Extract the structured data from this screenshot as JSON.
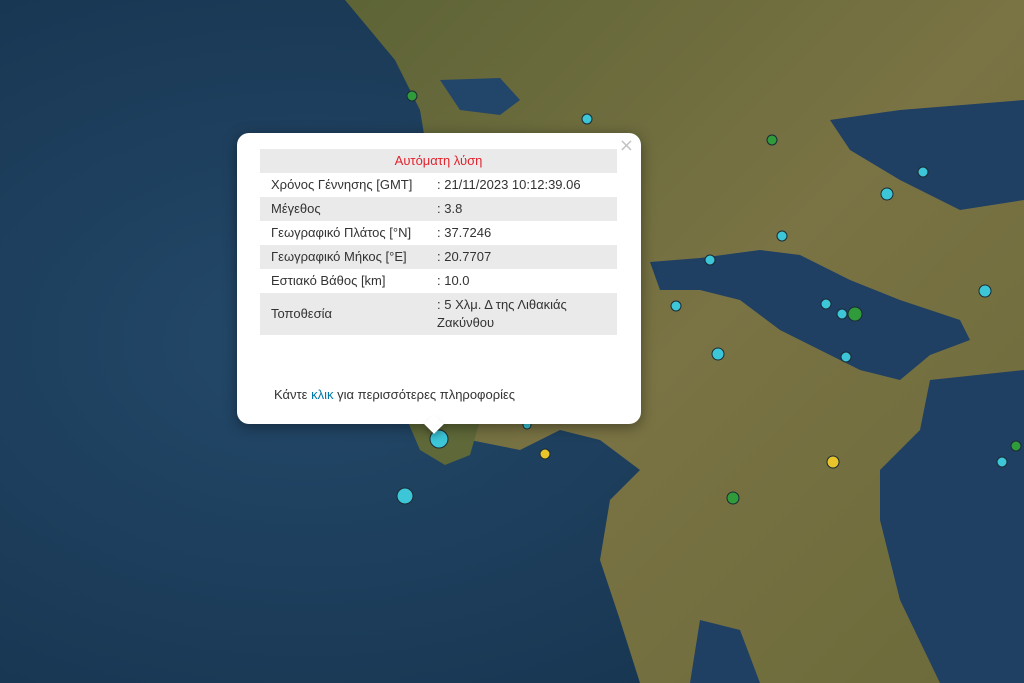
{
  "map": {
    "colors": {
      "sea": "#1d3f5e",
      "land": "#6e6a3e",
      "marker_cyan": "#3cc6d8",
      "marker_green": "#2f9b3b",
      "marker_yellow": "#e8c52b"
    }
  },
  "popup": {
    "close_icon": "×",
    "title": "Αυτόματη λύση",
    "rows": [
      {
        "label": "Χρόνος Γέννησης [GMT]",
        "value": ": 21/11/2023 10:12:39.06"
      },
      {
        "label": "Μέγεθος",
        "value": ": 3.8"
      },
      {
        "label": "Γεωγραφικό Πλάτος [°N]",
        "value": ": 37.7246"
      },
      {
        "label": "Γεωγραφικό Μήκος [°E]",
        "value": ": 20.7707"
      },
      {
        "label": "Εστιακό Βάθος [km]",
        "value": ": 10.0"
      },
      {
        "label": "Τοποθεσία",
        "value": ": 5 Χλμ. Δ της Λιθακιάς Ζακύνθου"
      }
    ],
    "footer": {
      "before": "Κάντε ",
      "link": "κλικ",
      "after": " για περισσότερες πληροφορίες"
    }
  }
}
